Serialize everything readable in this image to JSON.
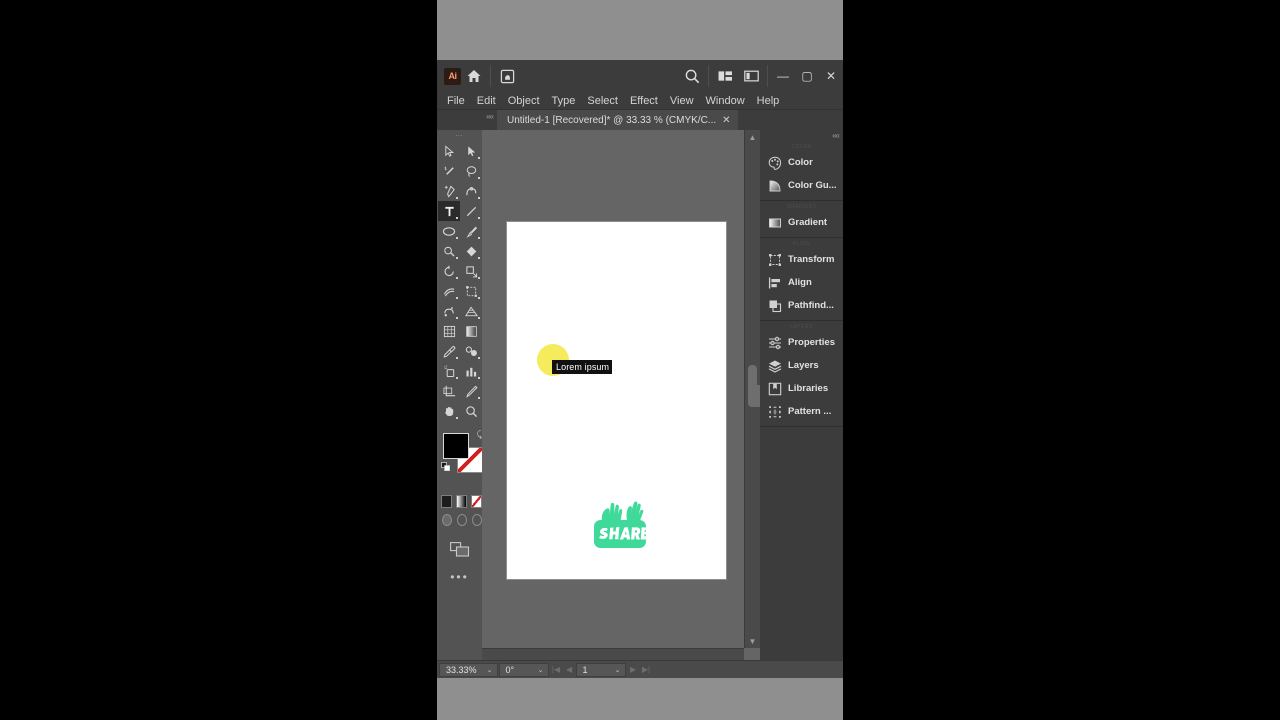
{
  "window": {
    "app_badge": "Ai",
    "titlebar_icons": [
      "home-icon",
      "stock-icon",
      "search-icon",
      "arrange-documents-icon",
      "workspace-switcher-icon"
    ],
    "minimize": "—",
    "maximize": "▢",
    "close": "✕"
  },
  "menubar": {
    "items": [
      {
        "label": "File"
      },
      {
        "label": "Edit"
      },
      {
        "label": "Object"
      },
      {
        "label": "Type"
      },
      {
        "label": "Select"
      },
      {
        "label": "Effect"
      },
      {
        "label": "View"
      },
      {
        "label": "Window"
      },
      {
        "label": "Help"
      }
    ]
  },
  "tabbar": {
    "collapse_glyph": "««",
    "document_title": "Untitled-1 [Recovered]* @ 33.33 % (CMYK/C...",
    "close_glyph": "✕"
  },
  "tools": {
    "grip_glyph": "⋯",
    "items": [
      {
        "name": "selection-tool",
        "active": false
      },
      {
        "name": "direct-selection-tool",
        "active": false
      },
      {
        "name": "magic-wand-tool",
        "active": false
      },
      {
        "name": "lasso-tool",
        "active": false
      },
      {
        "name": "pen-tool",
        "active": false
      },
      {
        "name": "curvature-tool",
        "active": false
      },
      {
        "name": "type-tool",
        "active": true
      },
      {
        "name": "line-segment-tool",
        "active": false
      },
      {
        "name": "ellipse-tool",
        "active": false
      },
      {
        "name": "paintbrush-tool",
        "active": false
      },
      {
        "name": "shaper-tool",
        "active": false
      },
      {
        "name": "eraser-tool",
        "active": false
      },
      {
        "name": "rotate-tool",
        "active": false
      },
      {
        "name": "scale-tool",
        "active": false
      },
      {
        "name": "width-tool",
        "active": false
      },
      {
        "name": "free-transform-tool",
        "active": false
      },
      {
        "name": "shape-builder-tool",
        "active": false
      },
      {
        "name": "perspective-grid-tool",
        "active": false
      },
      {
        "name": "mesh-tool",
        "active": false
      },
      {
        "name": "gradient-tool",
        "active": false
      },
      {
        "name": "eyedropper-tool",
        "active": false
      },
      {
        "name": "blend-tool",
        "active": false
      },
      {
        "name": "symbol-sprayer-tool",
        "active": false
      },
      {
        "name": "column-graph-tool",
        "active": false
      },
      {
        "name": "artboard-tool",
        "active": false
      },
      {
        "name": "slice-tool",
        "active": false
      },
      {
        "name": "hand-tool",
        "active": false
      },
      {
        "name": "zoom-tool",
        "active": false
      }
    ],
    "fill_color": "#000000",
    "stroke_color": "#ffffff",
    "more_tools_glyph": "•••"
  },
  "panels": {
    "collapse_glyph": "««",
    "groups": [
      {
        "title": "COLOR",
        "items": [
          {
            "icon": "color-panel-icon",
            "label": "Color"
          },
          {
            "icon": "color-guide-panel-icon",
            "label": "Color Gu..."
          }
        ]
      },
      {
        "title": "GRADIENT",
        "items": [
          {
            "icon": "gradient-panel-icon",
            "label": "Gradient"
          }
        ]
      },
      {
        "title": "ALIGN",
        "items": [
          {
            "icon": "transform-panel-icon",
            "label": "Transform"
          },
          {
            "icon": "align-panel-icon",
            "label": "Align"
          },
          {
            "icon": "pathfinder-panel-icon",
            "label": "Pathfind..."
          }
        ]
      },
      {
        "title": "LAYERS",
        "items": [
          {
            "icon": "properties-panel-icon",
            "label": "Properties"
          },
          {
            "icon": "layers-panel-icon",
            "label": "Layers"
          },
          {
            "icon": "libraries-panel-icon",
            "label": "Libraries"
          },
          {
            "icon": "pattern-options-panel-icon",
            "label": "Pattern ..."
          }
        ]
      }
    ]
  },
  "canvas": {
    "text_object": "Lorem ipsum",
    "yellow_circle_color": "#f4ec5c",
    "logo_text": "SHARE",
    "logo_color": "#3fd99a",
    "artboard_color": "#ffffff"
  },
  "statusbar": {
    "zoom_level": "33.33%",
    "rotation": "0°",
    "page_number": "1",
    "first_page_glyph": "|◀",
    "prev_page_glyph": "◀",
    "next_page_glyph": "▶",
    "last_page_glyph": "▶|",
    "caret_glyph": "⌄"
  }
}
